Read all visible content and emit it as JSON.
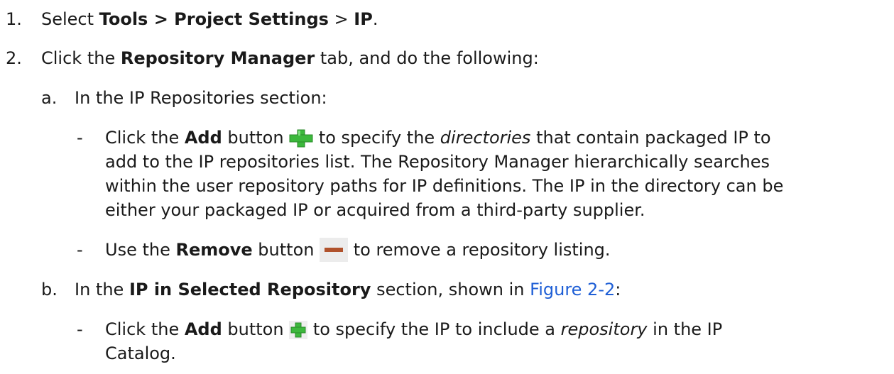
{
  "step1": {
    "num": "1.",
    "t1": "Select ",
    "b1": "Tools > Project Settings",
    "t2": " > ",
    "b2": "IP",
    "t3": "."
  },
  "step2": {
    "num": "2.",
    "t1": "Click the ",
    "b1": "Repository Manager",
    "t2": " tab, and do the following:"
  },
  "stepA": {
    "num": "a.",
    "text": "In the IP Repositories section:"
  },
  "addBullet": {
    "dash": "-",
    "t1": "Click the ",
    "b1": "Add",
    "t2": " button ",
    "t3": " to specify the ",
    "i1": "directories",
    "t4": " that contain packaged IP to",
    "l2": "add to the IP repositories list. The Repository Manager hierarchically searches",
    "l3": "within the user repository paths for IP definitions. The IP in the directory can be",
    "l4": "either your packaged IP or acquired from a third-party supplier."
  },
  "removeBullet": {
    "dash": "-",
    "t1": "Use the ",
    "b1": "Remove",
    "t2": " button ",
    "t3": " to remove a repository listing."
  },
  "stepB": {
    "num": "b.",
    "t1": "In the ",
    "b1": "IP in Selected Repository",
    "t2": " section, shown in ",
    "link": "Figure 2-2",
    "t3": ":"
  },
  "addIpBullet": {
    "dash": "-",
    "t1": "Click the ",
    "b1": "Add",
    "t2": " button ",
    "t3": " to specify the IP to include a ",
    "i1": "repository",
    "t4": " in the IP",
    "l2": "Catalog."
  },
  "colors": {
    "text": "#1a1a1a",
    "link": "#1f5fd6",
    "plus_green": "#3cb83c",
    "remove_bar": "#b0522c"
  },
  "icons": [
    "add-green-plus-icon",
    "remove-minus-icon",
    "add-ip-plus-icon"
  ]
}
